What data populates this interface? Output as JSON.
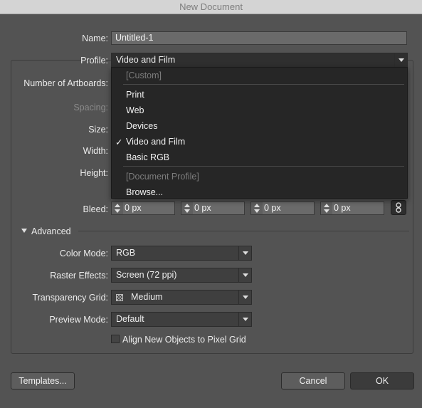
{
  "window": {
    "title": "New Document"
  },
  "form": {
    "name_label": "Name:",
    "name_value": "Untitled-1",
    "profile_label": "Profile:",
    "profile_value": "Video and Film",
    "artboards_label": "Number of Artboards:",
    "spacing_label": "Spacing:",
    "size_label": "Size:",
    "width_label": "Width:",
    "height_label": "Height:",
    "bleed_label": "Bleed:",
    "bleed_values": [
      "0 px",
      "0 px",
      "0 px",
      "0 px"
    ]
  },
  "profile_menu": {
    "selected": "Video and Film",
    "items": [
      {
        "label": "[Custom]",
        "disabled": true
      },
      {
        "label": "Print",
        "disabled": false
      },
      {
        "label": "Web",
        "disabled": false
      },
      {
        "label": "Devices",
        "disabled": false
      },
      {
        "label": "Video and Film",
        "disabled": false,
        "checked": true,
        "check_glyph": "✓"
      },
      {
        "label": "Basic RGB",
        "disabled": false
      },
      {
        "label": "[Document Profile]",
        "disabled": true
      },
      {
        "label": "Browse...",
        "disabled": false
      }
    ]
  },
  "advanced": {
    "section_label": "Advanced",
    "color_mode_label": "Color Mode:",
    "color_mode_value": "RGB",
    "raster_label": "Raster Effects:",
    "raster_value": "Screen (72 ppi)",
    "transparency_label": "Transparency Grid:",
    "transparency_value": "Medium",
    "preview_label": "Preview Mode:",
    "preview_value": "Default",
    "align_checkbox_label": "Align New Objects to Pixel Grid",
    "align_checked": false
  },
  "buttons": {
    "templates": "Templates...",
    "cancel": "Cancel",
    "ok": "OK"
  },
  "colors": {
    "dialog_bg": "#535353",
    "menu_bg": "#262626",
    "field_bg": "#6a6a6a"
  }
}
